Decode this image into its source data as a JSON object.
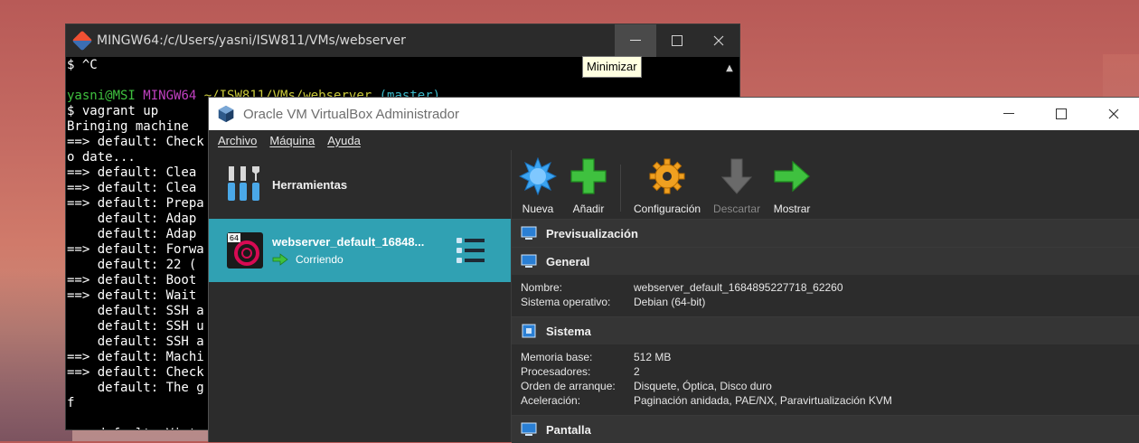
{
  "terminal": {
    "title": "MINGW64:/c/Users/yasni/ISW811/VMs/webserver",
    "lines": [
      {
        "text": "$ ^C"
      },
      {
        "text": ""
      },
      {
        "prompt": true,
        "user": "yasni@MSI",
        "env": "MINGW64",
        "path": "~/ISW811/VMs/webserver",
        "branch": "(master)"
      },
      {
        "text": "$ vagrant up"
      },
      {
        "text": "Bringing machine"
      },
      {
        "text": "==> default: Check"
      },
      {
        "text": "o date..."
      },
      {
        "text": "==> default: Clea"
      },
      {
        "text": "==> default: Clea"
      },
      {
        "text": "==> default: Prepa"
      },
      {
        "text": "    default: Adap"
      },
      {
        "text": "    default: Adap"
      },
      {
        "text": "==> default: Forwa"
      },
      {
        "text": "    default: 22 ("
      },
      {
        "text": "==> default: Boot"
      },
      {
        "text": "==> default: Wait"
      },
      {
        "text": "    default: SSH a"
      },
      {
        "text": "    default: SSH u"
      },
      {
        "text": "    default: SSH a"
      },
      {
        "text": "==> default: Machi"
      },
      {
        "text": "==> default: Check"
      },
      {
        "text": "    default: The g"
      },
      {
        "text": "f"
      },
      {
        "text": ""
      },
      {
        "text": "    default: Virtu"
      }
    ]
  },
  "tooltip": "Minimizar",
  "vbox": {
    "title": "Oracle VM VirtualBox Administrador",
    "menu": [
      "Archivo",
      "Máquina",
      "Ayuda"
    ],
    "tools_label": "Herramientas",
    "vm": {
      "name": "webserver_default_16848...",
      "state": "Corriendo"
    },
    "toolbar": {
      "nueva": "Nueva",
      "anadir": "Añadir",
      "configuracion": "Configuración",
      "descartar": "Descartar",
      "mostrar": "Mostrar"
    },
    "sections": {
      "preview": "Previsualización",
      "general": "General",
      "general_rows": [
        {
          "k": "Nombre:",
          "v": "webserver_default_1684895227718_62260"
        },
        {
          "k": "Sistema operativo:",
          "v": "Debian (64-bit)"
        }
      ],
      "sistema": "Sistema",
      "sistema_rows": [
        {
          "k": "Memoria base:",
          "v": "512 MB"
        },
        {
          "k": "Procesadores:",
          "v": "2"
        },
        {
          "k": "Orden de arranque:",
          "v": "Disquete, Óptica, Disco duro"
        },
        {
          "k": "Aceleración:",
          "v": "Paginación anidada, PAE/NX, Paravirtualización KVM"
        }
      ],
      "pantalla": "Pantalla"
    }
  },
  "colors": {
    "selection": "#30a1b3",
    "accent_green": "#3fc13f"
  }
}
